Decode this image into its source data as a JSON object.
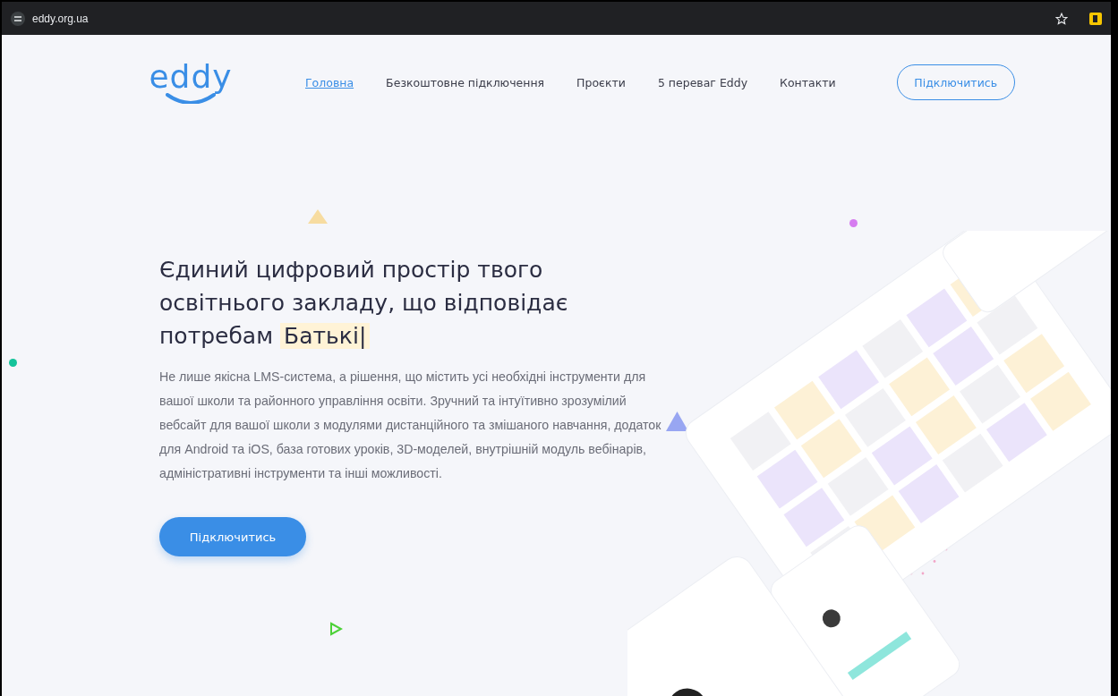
{
  "browser": {
    "url": "eddy.org.ua"
  },
  "header": {
    "logo": "eddy",
    "nav": [
      {
        "label": "Головна",
        "selected": true
      },
      {
        "label": "Безкоштовне підключення",
        "selected": false
      },
      {
        "label": "Проєкти",
        "selected": false
      },
      {
        "label": "5 переваг Eddy",
        "selected": false
      },
      {
        "label": "Контакти",
        "selected": false
      }
    ],
    "cta": "Підключитись"
  },
  "hero": {
    "heading": [
      "Єдиний цифровий простір твого",
      "освітнього закладу, що відповідає",
      "потребам"
    ],
    "typed_word": "Батькі|",
    "description": "Не лише якісна LMS-система, а рішення, що містить усі необхідні інструменти для вашої школи та районного управління освіти. Зручний та інтуїтивно зрозумілий вебсайт для вашої школи з модулями дистанційного та змішаного навчання, додаток для Android та iOS, база готових уроків, 3D-моделей, внутрішній модуль вебінарів, адміністративні інструменти та інші можливості.",
    "button": "Підключитись"
  }
}
